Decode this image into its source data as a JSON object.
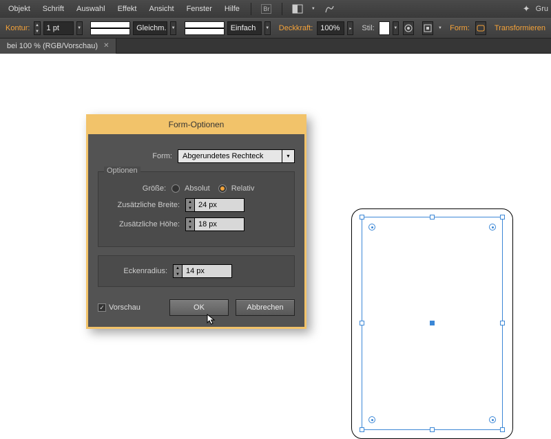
{
  "menubar": {
    "items": [
      "Objekt",
      "Schrift",
      "Auswahl",
      "Effekt",
      "Ansicht",
      "Fenster",
      "Hilfe"
    ],
    "right_label": "Gru"
  },
  "toolbar": {
    "kontur_label": "Kontur:",
    "kontur_value": "1 pt",
    "stroke_profile": "Gleichm.",
    "brush": "Einfach",
    "deckkraft_label": "Deckkraft:",
    "deckkraft_value": "100%",
    "stil_label": "Stil:",
    "form_label": "Form:",
    "transform_label": "Transformieren"
  },
  "tab": {
    "title": "bei 100 % (RGB/Vorschau)"
  },
  "dialog": {
    "title": "Form-Optionen",
    "form_label": "Form:",
    "form_value": "Abgerundetes Rechteck",
    "optionen_legend": "Optionen",
    "groesse_label": "Größe:",
    "absolut_label": "Absolut",
    "relativ_label": "Relativ",
    "size_mode": "Relativ",
    "extra_width_label": "Zusätzliche Breite:",
    "extra_width_value": "24 px",
    "extra_height_label": "Zusätzliche Höhe:",
    "extra_height_value": "18 px",
    "eckenradius_label": "Eckenradius:",
    "eckenradius_value": "14 px",
    "vorschau_label": "Vorschau",
    "vorschau_checked": true,
    "ok_label": "OK",
    "cancel_label": "Abbrechen"
  }
}
